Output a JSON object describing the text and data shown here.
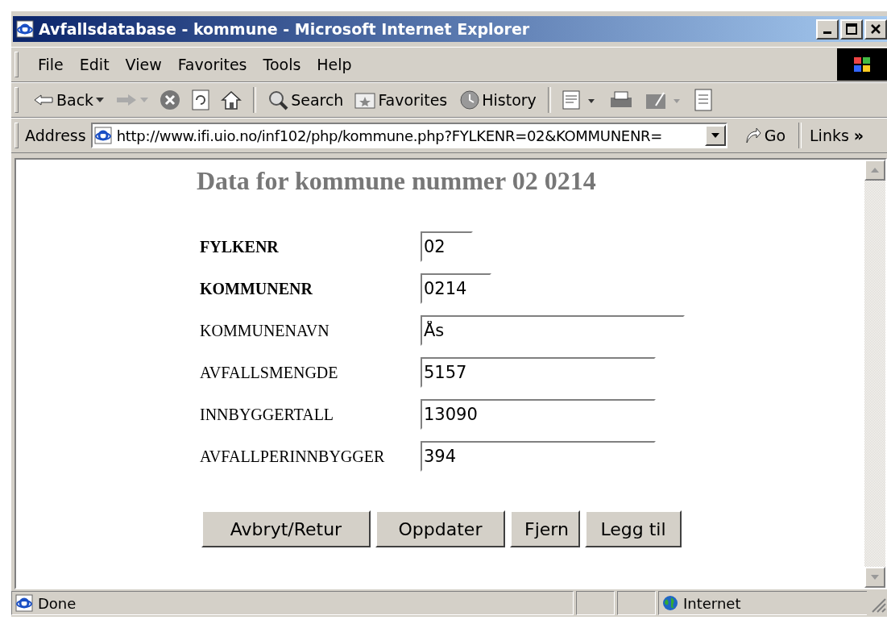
{
  "window": {
    "title": "Avfallsdatabase - kommune - Microsoft Internet Explorer"
  },
  "menu": [
    "File",
    "Edit",
    "View",
    "Favorites",
    "Tools",
    "Help"
  ],
  "toolbar": [
    {
      "kind": "back",
      "label": "Back"
    },
    {
      "kind": "forward"
    },
    {
      "kind": "stop"
    },
    {
      "kind": "refresh"
    },
    {
      "kind": "home"
    },
    {
      "kind": "search",
      "label": "Search"
    },
    {
      "kind": "favorites",
      "label": "Favorites"
    },
    {
      "kind": "history",
      "label": "History"
    },
    {
      "kind": "mail"
    },
    {
      "kind": "print"
    },
    {
      "kind": "edit"
    },
    {
      "kind": "discuss"
    }
  ],
  "address": {
    "label": "Address",
    "value": "http://www.ifi.uio.no/inf102/php/kommune.php?FYLKENR=02&KOMMUNENR=",
    "go": "Go",
    "links": "Links",
    "more": "»"
  },
  "page": {
    "heading": "Data for kommune nummer 02 0214",
    "fields": [
      {
        "label": "FYLKENR",
        "value": "02",
        "key": true
      },
      {
        "label": "KOMMUNENR",
        "value": "0214",
        "key": true
      },
      {
        "label": "KOMMUNENAVN",
        "value": "Ås",
        "key": false
      },
      {
        "label": "AVFALLSMENGDE",
        "value": "5157",
        "key": false
      },
      {
        "label": "INNBYGGERTALL",
        "value": "13090",
        "key": false
      },
      {
        "label": "AVFALLPERINNBYGGER",
        "value": "394",
        "key": false
      }
    ],
    "buttons": [
      "Avbryt/Retur",
      "Oppdater",
      "Fjern",
      "Legg til"
    ]
  },
  "status_bar": {
    "text": "Done",
    "zone": "Internet"
  }
}
